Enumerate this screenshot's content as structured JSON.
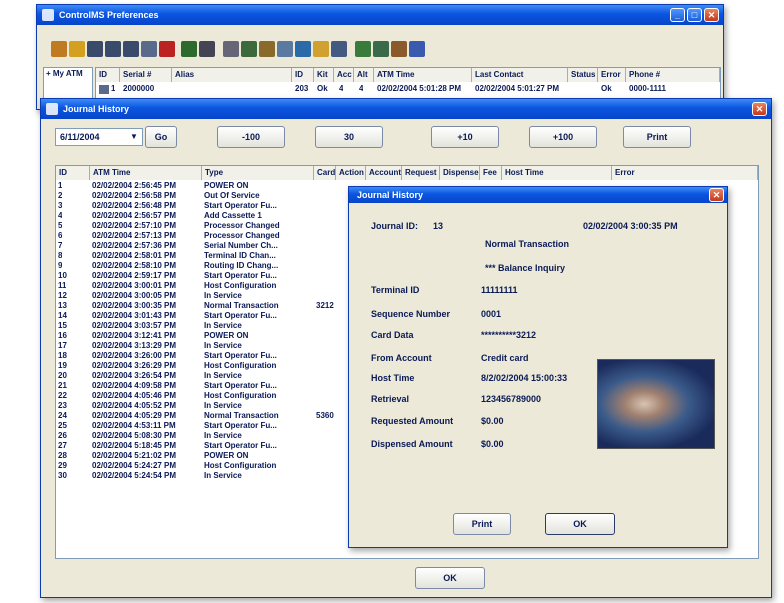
{
  "back_window": {
    "title": "ControlMS Preferences",
    "columns": [
      "ID",
      "Serial #",
      "Alias",
      "ID",
      "Kit",
      "Acc",
      "Alt",
      "ATM Time",
      "Last Contact",
      "Status",
      "Error",
      "Phone #"
    ],
    "row": {
      "id": "1",
      "serial": "2000000",
      "c3": "203",
      "c4": "Ok",
      "c5": "4",
      "c6": "4",
      "atm_time": "02/02/2004 5:01:28 PM",
      "last_contact": "02/02/2004 5:01:27 PM",
      "status": "Ok",
      "phone": "0000-1111"
    },
    "left_label": "+ My ATM"
  },
  "journal": {
    "title": "Journal History",
    "date_value": "6/11/2004",
    "go_label": "Go",
    "nav_buttons": [
      "-100",
      "30",
      "+10",
      "+100",
      "Print"
    ],
    "columns": [
      "ID",
      "ATM Time",
      "Type",
      "Card",
      "Action",
      "Account",
      "Request",
      "Dispense",
      "Fee",
      "Host Time",
      "Error"
    ],
    "rows": [
      {
        "id": "1",
        "time": "02/02/2004 2:56:45 PM",
        "type": "POWER ON",
        "card": ""
      },
      {
        "id": "2",
        "time": "02/02/2004 2:56:58 PM",
        "type": "Out Of Service",
        "card": ""
      },
      {
        "id": "3",
        "time": "02/02/2004 2:56:48 PM",
        "type": "Start Operator Fu...",
        "card": ""
      },
      {
        "id": "4",
        "time": "02/02/2004 2:56:57 PM",
        "type": "Add Cassette 1",
        "card": ""
      },
      {
        "id": "5",
        "time": "02/02/2004 2:57:10 PM",
        "type": "Processor Changed",
        "card": ""
      },
      {
        "id": "6",
        "time": "02/02/2004 2:57:13 PM",
        "type": "Processor Changed",
        "card": ""
      },
      {
        "id": "7",
        "time": "02/02/2004 2:57:36 PM",
        "type": "Serial Number Ch...",
        "card": ""
      },
      {
        "id": "8",
        "time": "02/02/2004 2:58:01 PM",
        "type": "Terminal ID Chan...",
        "card": ""
      },
      {
        "id": "9",
        "time": "02/02/2004 2:58:10 PM",
        "type": "Routing ID Chang...",
        "card": ""
      },
      {
        "id": "10",
        "time": "02/02/2004 2:59:17 PM",
        "type": "Start Operator Fu...",
        "card": ""
      },
      {
        "id": "11",
        "time": "02/02/2004 3:00:01 PM",
        "type": "Host Configuration",
        "card": ""
      },
      {
        "id": "12",
        "time": "02/02/2004 3:00:05 PM",
        "type": "In Service",
        "card": ""
      },
      {
        "id": "13",
        "time": "02/02/2004 3:00:35 PM",
        "type": "Normal Transaction",
        "card": "3212"
      },
      {
        "id": "14",
        "time": "02/02/2004 3:01:43 PM",
        "type": "Start Operator Fu...",
        "card": ""
      },
      {
        "id": "15",
        "time": "02/02/2004 3:03:57 PM",
        "type": "In Service",
        "card": ""
      },
      {
        "id": "16",
        "time": "02/02/2004 3:12:41 PM",
        "type": "POWER ON",
        "card": ""
      },
      {
        "id": "17",
        "time": "02/02/2004 3:13:29 PM",
        "type": "In Service",
        "card": ""
      },
      {
        "id": "18",
        "time": "02/02/2004 3:26:00 PM",
        "type": "Start Operator Fu...",
        "card": ""
      },
      {
        "id": "19",
        "time": "02/02/2004 3:26:29 PM",
        "type": "Host Configuration",
        "card": ""
      },
      {
        "id": "20",
        "time": "02/02/2004 3:26:54 PM",
        "type": "In Service",
        "card": ""
      },
      {
        "id": "21",
        "time": "02/02/2004 4:09:58 PM",
        "type": "Start Operator Fu...",
        "card": ""
      },
      {
        "id": "22",
        "time": "02/02/2004 4:05:46 PM",
        "type": "Host Configuration",
        "card": ""
      },
      {
        "id": "23",
        "time": "02/02/2004 4:05:52 PM",
        "type": "In Service",
        "card": ""
      },
      {
        "id": "24",
        "time": "02/02/2004 4:05:29 PM",
        "type": "Normal Transaction",
        "card": "5360"
      },
      {
        "id": "25",
        "time": "02/02/2004 4:53:11 PM",
        "type": "Start Operator Fu...",
        "card": ""
      },
      {
        "id": "26",
        "time": "02/02/2004 5:08:30 PM",
        "type": "In Service",
        "card": ""
      },
      {
        "id": "27",
        "time": "02/02/2004 5:18:45 PM",
        "type": "Start Operator Fu...",
        "card": ""
      },
      {
        "id": "28",
        "time": "02/02/2004 5:21:02 PM",
        "type": "POWER ON",
        "card": ""
      },
      {
        "id": "29",
        "time": "02/02/2004 5:24:27 PM",
        "type": "Host Configuration",
        "card": ""
      },
      {
        "id": "30",
        "time": "02/02/2004 5:24:54 PM",
        "type": "In Service",
        "card": ""
      }
    ],
    "ok_label": "OK"
  },
  "detail": {
    "title": "Journal History",
    "journal_id_label": "Journal ID:",
    "journal_id": "13",
    "datetime": "02/02/2004 3:00:35 PM",
    "tx_type": "Normal Transaction",
    "tx_sub": "*** Balance Inquiry",
    "fields": [
      {
        "label": "Terminal ID",
        "value": "11111111"
      },
      {
        "label": "Sequence Number",
        "value": "0001"
      },
      {
        "label": "Card Data",
        "value": "**********3212"
      },
      {
        "label": "From Account",
        "value": "Credit card"
      },
      {
        "label": "Host Time",
        "value": "8/2/02/2004 15:00:33"
      },
      {
        "label": "Retrieval",
        "value": "123456789000"
      },
      {
        "label": "Requested Amount",
        "value": "$0.00"
      },
      {
        "label": "Dispensed Amount",
        "value": "$0.00"
      }
    ],
    "print_label": "Print",
    "ok_label": "OK"
  },
  "colors": {
    "titlebar": "#0a55e0",
    "chrome": "#ece9d8",
    "text": "#0a1a55"
  }
}
